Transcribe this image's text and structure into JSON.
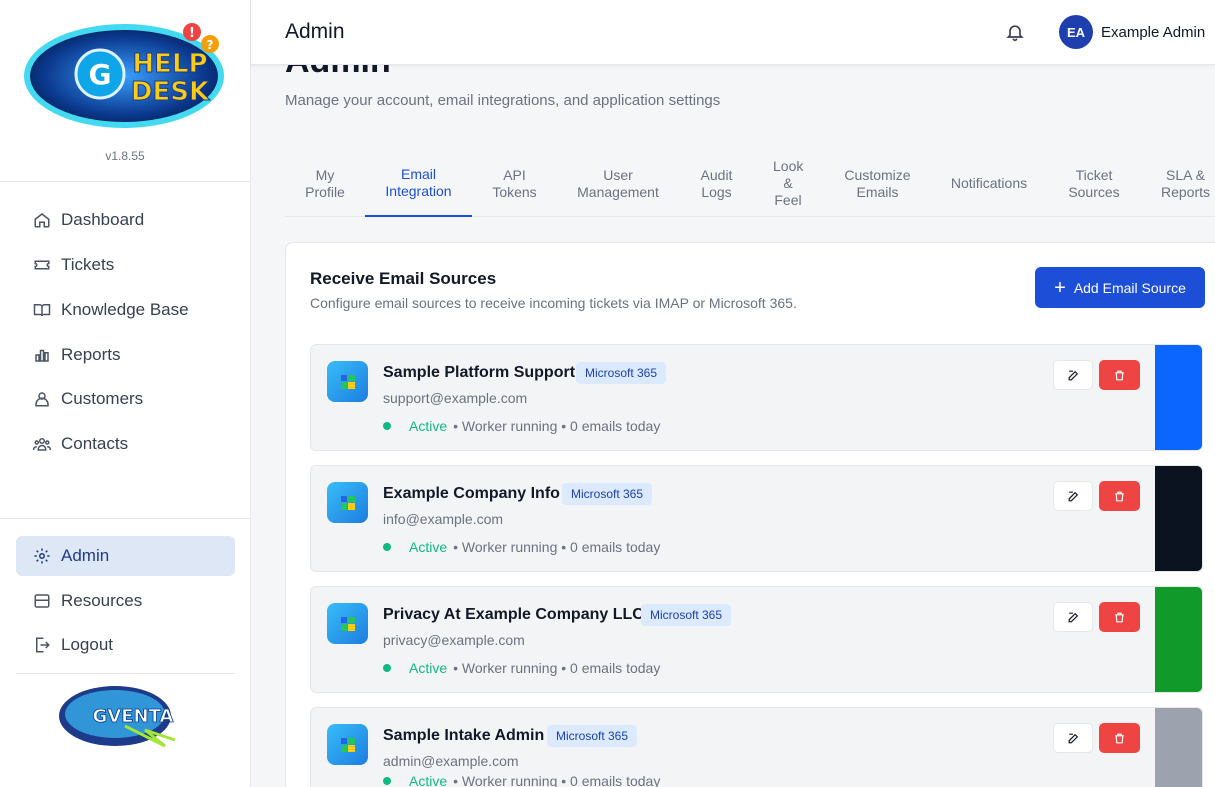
{
  "sidebar": {
    "logo_text_1": "HELP",
    "logo_text_2": "DESK",
    "logo_letter": "G",
    "version": "v1.8.55",
    "items": [
      {
        "label": "Dashboard",
        "icon": "home-icon"
      },
      {
        "label": "Tickets",
        "icon": "ticket-icon"
      },
      {
        "label": "Knowledge Base",
        "icon": "book-icon"
      },
      {
        "label": "Reports",
        "icon": "bar-chart-icon"
      },
      {
        "label": "Customers",
        "icon": "users-icon"
      },
      {
        "label": "Contacts",
        "icon": "contacts-icon"
      }
    ],
    "bottom_items": [
      {
        "label": "Admin",
        "icon": "gear-icon",
        "active": true
      },
      {
        "label": "Resources",
        "icon": "resources-icon"
      },
      {
        "label": "Logout",
        "icon": "logout-icon"
      }
    ],
    "bottom_logo_text": "GVENTA"
  },
  "header": {
    "title": "Admin",
    "avatar_initials": "EA",
    "user_name": "Example Admin"
  },
  "page": {
    "heading": "Admin",
    "subtitle": "Manage your account, email integrations, and application settings"
  },
  "tabs": [
    {
      "label": "My Profile"
    },
    {
      "label": "Email Integration",
      "active": true
    },
    {
      "label": "API Tokens"
    },
    {
      "label": "User Management"
    },
    {
      "label": "Audit Logs"
    },
    {
      "label": "Look & Feel"
    },
    {
      "label": "Customize Emails"
    },
    {
      "label": "Notifications"
    },
    {
      "label": "Ticket Sources"
    },
    {
      "label": "SLA & Reports"
    }
  ],
  "panel": {
    "title": "Receive Email Sources",
    "subtitle": "Configure email sources to receive incoming tickets via IMAP or Microsoft 365.",
    "add_button": "Add Email Source"
  },
  "sources": [
    {
      "name": "Sample Platform Support",
      "badge": "Microsoft 365",
      "email": "support@example.com",
      "status": "Active",
      "details": "• Worker running • 0 emails today",
      "color": "#0a66ff"
    },
    {
      "name": "Example Company Info",
      "badge": "Microsoft 365",
      "email": "info@example.com",
      "status": "Active",
      "details": "• Worker running • 0 emails today",
      "color": "#0b1220"
    },
    {
      "name": "Privacy At Example Company LLC",
      "badge": "Microsoft 365",
      "email": "privacy@example.com",
      "status": "Active",
      "details": "• Worker running • 0 emails today",
      "color": "#0f9a2a"
    },
    {
      "name": "Sample Intake Admin",
      "badge": "Microsoft 365",
      "email": "admin@example.com",
      "status": "Active",
      "details": "• Worker running • 0 emails today",
      "color": "#9ca3af"
    }
  ],
  "colors": {
    "primary": "#1d4ed8",
    "danger": "#ef4444",
    "success": "#10b981"
  }
}
